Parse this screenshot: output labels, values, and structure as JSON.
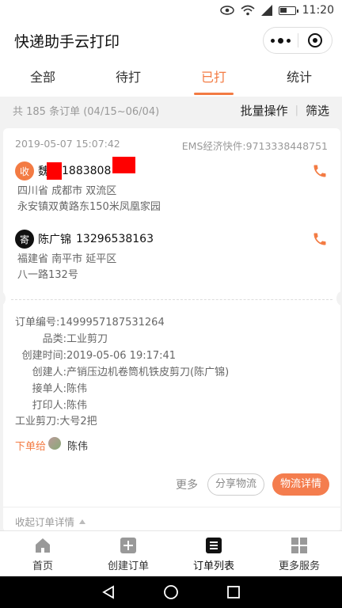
{
  "status_bar": {
    "time": "11:20"
  },
  "app": {
    "title": "快递助手云打印"
  },
  "tabs": [
    {
      "label": "全部"
    },
    {
      "label": "待打"
    },
    {
      "label": "已打"
    },
    {
      "label": "统计"
    }
  ],
  "summary": {
    "count_text": "共 185 条订单 (04/15~06/04)",
    "batch_label": "批量操作",
    "divider": "|",
    "filter_label": "筛选"
  },
  "order": {
    "datetime": "2019-05-07 15:07:42",
    "carrier_tracking": "EMS经济快件:9713338448751",
    "receiver": {
      "badge": "收",
      "name": "魏",
      "phone": "1883808",
      "province_city": "四川省 成都市 双流区",
      "street": "永安镇双黄路东150米凤凰家园"
    },
    "sender": {
      "badge": "寄",
      "name": "陈广锦",
      "phone": "13296538163",
      "province_city": "福建省 南平市 延平区",
      "street": "八一路132号"
    },
    "details": [
      {
        "key": "订单编号:",
        "value": "1499957187531264"
      },
      {
        "key": "品类:",
        "value": "工业剪刀"
      },
      {
        "key": "创建时间:",
        "value": "2019-05-06 19:17:41"
      },
      {
        "key": "创建人:",
        "value": "产销压边机卷筒机铁皮剪刀(陈广锦)"
      },
      {
        "key": "接单人:",
        "value": "陈伟"
      },
      {
        "key": "打印人:",
        "value": "陈伟"
      }
    ],
    "items_text": "工业剪刀:大号2把",
    "assign_label": "下单给",
    "assign_name": "陈伟",
    "more_label": "更多",
    "share_label": "分享物流",
    "logistics_label": "物流详情",
    "collapse_label": "收起订单详情"
  },
  "bottom_nav": [
    {
      "label": "首页",
      "icon": "home-icon"
    },
    {
      "label": "创建订单",
      "icon": "plus-square-icon"
    },
    {
      "label": "订单列表",
      "icon": "list-icon"
    },
    {
      "label": "更多服务",
      "icon": "grid-icon"
    }
  ],
  "colors": {
    "accent": "#f37b43",
    "redaction": "#ff0000"
  }
}
